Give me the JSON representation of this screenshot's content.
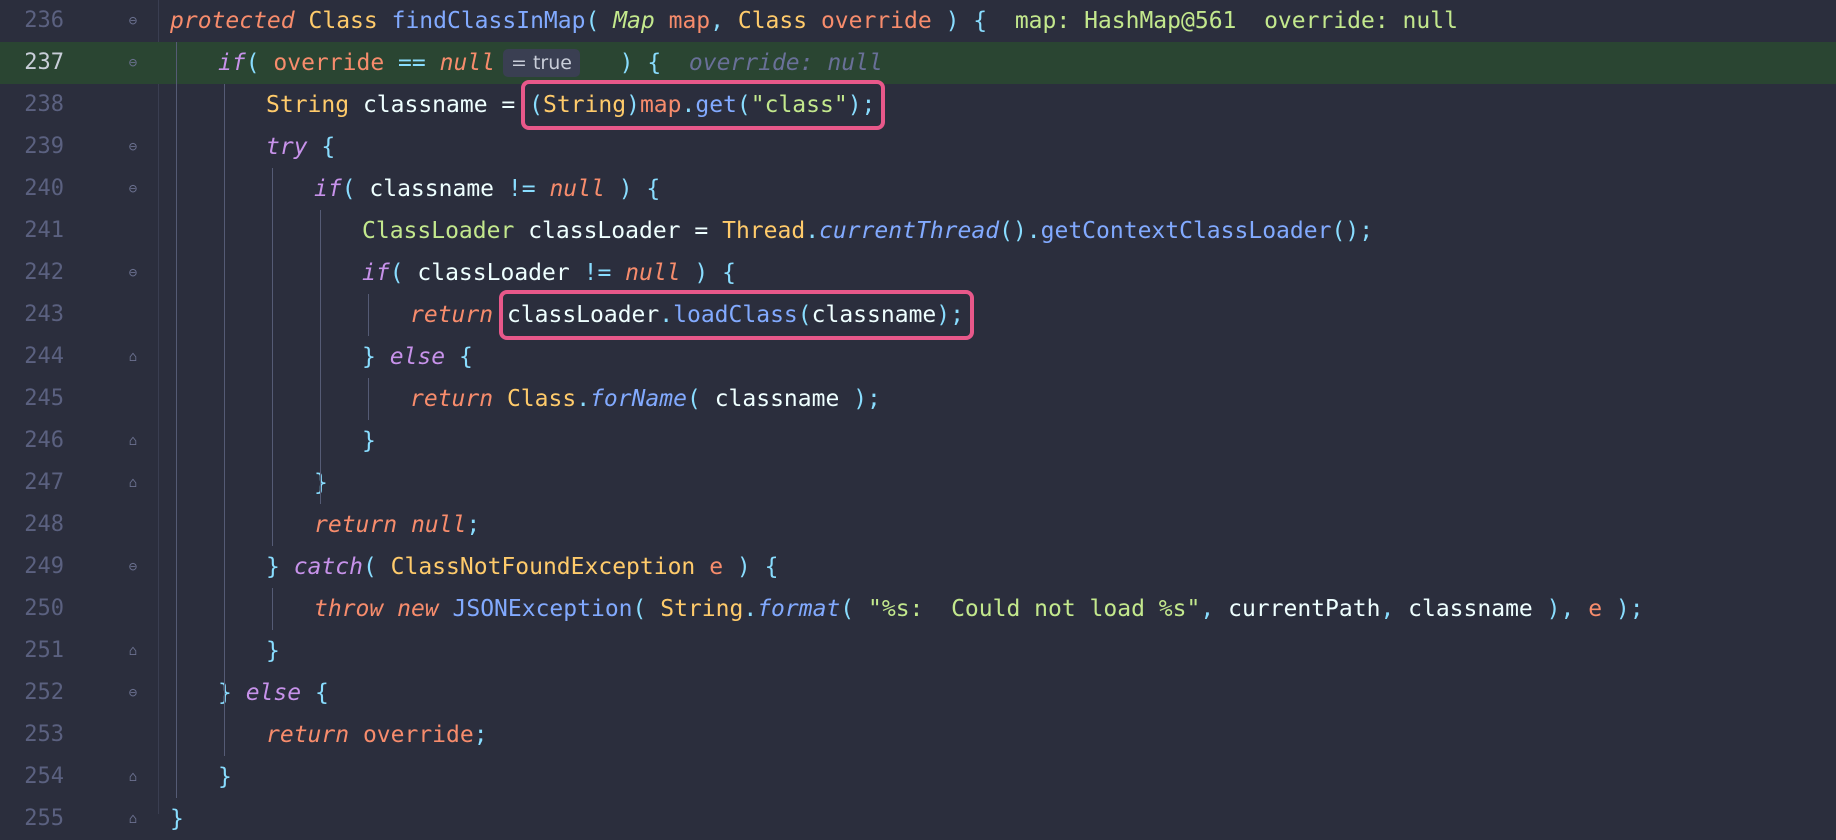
{
  "editor": {
    "current_line": 237,
    "colors": {
      "background": "#2b2e3d",
      "current_line": "#2a4532",
      "highlight_box": "#e8588a"
    },
    "lines": [
      {
        "no": "236",
        "fold": "open",
        "indent": 0,
        "tokens": [
          {
            "t": "protected",
            "c": "c-kwo"
          },
          {
            "t": " "
          },
          {
            "t": "Class",
            "c": "c-type"
          },
          {
            "t": " "
          },
          {
            "t": "findClassInMap",
            "c": "c-fn"
          },
          {
            "t": "( ",
            "c": "c-punc"
          },
          {
            "t": "Map",
            "c": "c-ital"
          },
          {
            "t": " "
          },
          {
            "t": "map",
            "c": "c-param"
          },
          {
            "t": ", ",
            "c": "c-punc"
          },
          {
            "t": "Class",
            "c": "c-type"
          },
          {
            "t": " "
          },
          {
            "t": "override",
            "c": "c-param"
          },
          {
            "t": " ) {",
            "c": "c-punc"
          },
          {
            "t": "  map: HashMap@561  override: null",
            "c": "c-dbg"
          }
        ]
      },
      {
        "no": "237",
        "fold": "open",
        "indent": 1,
        "tokens": [
          {
            "t": "if",
            "c": "c-kw"
          },
          {
            "t": "( ",
            "c": "c-punc"
          },
          {
            "t": "override",
            "c": "c-param"
          },
          {
            "t": " == ",
            "c": "c-punc"
          },
          {
            "t": "null",
            "c": "c-kwo"
          },
          {
            "t": "         ",
            "c": "c-id"
          },
          {
            "t": ") {",
            "c": "c-punc"
          },
          {
            "t": "  override: null",
            "c": "c-cmt"
          }
        ],
        "inline_value": "= true"
      },
      {
        "no": "238",
        "fold": "none",
        "indent": 2,
        "tokens": [
          {
            "t": "String",
            "c": "c-type"
          },
          {
            "t": " classname = ",
            "c": "c-id"
          },
          {
            "t": "(",
            "c": "c-punc"
          },
          {
            "t": "String",
            "c": "c-type"
          },
          {
            "t": ")",
            "c": "c-punc"
          },
          {
            "t": "map",
            "c": "c-param"
          },
          {
            "t": ".",
            "c": "c-punc"
          },
          {
            "t": "get",
            "c": "c-fn"
          },
          {
            "t": "(",
            "c": "c-punc"
          },
          {
            "t": "\"class\"",
            "c": "c-str"
          },
          {
            "t": ");",
            "c": "c-punc"
          }
        ]
      },
      {
        "no": "239",
        "fold": "open",
        "indent": 2,
        "tokens": [
          {
            "t": "try",
            "c": "c-kw"
          },
          {
            "t": " {",
            "c": "c-punc"
          }
        ]
      },
      {
        "no": "240",
        "fold": "open",
        "indent": 3,
        "tokens": [
          {
            "t": "if",
            "c": "c-kw"
          },
          {
            "t": "( ",
            "c": "c-punc"
          },
          {
            "t": "classname",
            "c": "c-id"
          },
          {
            "t": " != ",
            "c": "c-punc"
          },
          {
            "t": "null",
            "c": "c-kwo"
          },
          {
            "t": " ) {",
            "c": "c-punc"
          }
        ]
      },
      {
        "no": "241",
        "fold": "none",
        "indent": 4,
        "tokens": [
          {
            "t": "ClassLoader",
            "c": "c-typeg"
          },
          {
            "t": " classLoader = ",
            "c": "c-id"
          },
          {
            "t": "Thread",
            "c": "c-type"
          },
          {
            "t": ".",
            "c": "c-punc"
          },
          {
            "t": "currentThread",
            "c": "c-fni"
          },
          {
            "t": "().",
            "c": "c-punc"
          },
          {
            "t": "getContextClassLoader",
            "c": "c-fn"
          },
          {
            "t": "();",
            "c": "c-punc"
          }
        ]
      },
      {
        "no": "242",
        "fold": "open",
        "indent": 4,
        "tokens": [
          {
            "t": "if",
            "c": "c-kw"
          },
          {
            "t": "( ",
            "c": "c-punc"
          },
          {
            "t": "classLoader",
            "c": "c-id"
          },
          {
            "t": " != ",
            "c": "c-punc"
          },
          {
            "t": "null",
            "c": "c-kwo"
          },
          {
            "t": " ) {",
            "c": "c-punc"
          }
        ]
      },
      {
        "no": "243",
        "fold": "none",
        "indent": 5,
        "tokens": [
          {
            "t": "return",
            "c": "c-kwo"
          },
          {
            "t": " "
          },
          {
            "t": "classLoader",
            "c": "c-id"
          },
          {
            "t": ".",
            "c": "c-punc"
          },
          {
            "t": "loadClass",
            "c": "c-fn"
          },
          {
            "t": "(",
            "c": "c-punc"
          },
          {
            "t": "classname",
            "c": "c-id"
          },
          {
            "t": ");",
            "c": "c-punc"
          }
        ]
      },
      {
        "no": "244",
        "fold": "close",
        "indent": 4,
        "tokens": [
          {
            "t": "} ",
            "c": "c-punc"
          },
          {
            "t": "else",
            "c": "c-kw"
          },
          {
            "t": " {",
            "c": "c-punc"
          }
        ]
      },
      {
        "no": "245",
        "fold": "none",
        "indent": 5,
        "tokens": [
          {
            "t": "return",
            "c": "c-kwo"
          },
          {
            "t": " "
          },
          {
            "t": "Class",
            "c": "c-type"
          },
          {
            "t": ".",
            "c": "c-punc"
          },
          {
            "t": "forName",
            "c": "c-fni"
          },
          {
            "t": "( ",
            "c": "c-punc"
          },
          {
            "t": "classname",
            "c": "c-id"
          },
          {
            "t": " );",
            "c": "c-punc"
          }
        ]
      },
      {
        "no": "246",
        "fold": "close",
        "indent": 4,
        "tokens": [
          {
            "t": "}",
            "c": "c-punc"
          }
        ]
      },
      {
        "no": "247",
        "fold": "close",
        "indent": 3,
        "tokens": [
          {
            "t": "}",
            "c": "c-punc"
          }
        ]
      },
      {
        "no": "248",
        "fold": "none",
        "indent": 3,
        "tokens": [
          {
            "t": "return",
            "c": "c-kwo"
          },
          {
            "t": " "
          },
          {
            "t": "null",
            "c": "c-kwo"
          },
          {
            "t": ";",
            "c": "c-punc"
          }
        ]
      },
      {
        "no": "249",
        "fold": "open",
        "indent": 2,
        "tokens": [
          {
            "t": "} ",
            "c": "c-punc"
          },
          {
            "t": "catch",
            "c": "c-kw"
          },
          {
            "t": "( ",
            "c": "c-punc"
          },
          {
            "t": "ClassNotFoundException",
            "c": "c-type"
          },
          {
            "t": " "
          },
          {
            "t": "e",
            "c": "c-param"
          },
          {
            "t": " ) {",
            "c": "c-punc"
          }
        ]
      },
      {
        "no": "250",
        "fold": "none",
        "indent": 3,
        "tokens": [
          {
            "t": "throw",
            "c": "c-kwo"
          },
          {
            "t": " "
          },
          {
            "t": "new",
            "c": "c-kwo"
          },
          {
            "t": " "
          },
          {
            "t": "JSONException",
            "c": "c-fn"
          },
          {
            "t": "( ",
            "c": "c-punc"
          },
          {
            "t": "String",
            "c": "c-type"
          },
          {
            "t": ".",
            "c": "c-punc"
          },
          {
            "t": "format",
            "c": "c-fni"
          },
          {
            "t": "( ",
            "c": "c-punc"
          },
          {
            "t": "\"%s:  Could not load %s\"",
            "c": "c-str"
          },
          {
            "t": ", ",
            "c": "c-punc"
          },
          {
            "t": "currentPath",
            "c": "c-id"
          },
          {
            "t": ", ",
            "c": "c-punc"
          },
          {
            "t": "classname",
            "c": "c-id"
          },
          {
            "t": " ), ",
            "c": "c-punc"
          },
          {
            "t": "e",
            "c": "c-param"
          },
          {
            "t": " );",
            "c": "c-punc"
          }
        ]
      },
      {
        "no": "251",
        "fold": "close",
        "indent": 2,
        "tokens": [
          {
            "t": "}",
            "c": "c-punc"
          }
        ]
      },
      {
        "no": "252",
        "fold": "open",
        "indent": 1,
        "tokens": [
          {
            "t": "} ",
            "c": "c-punc"
          },
          {
            "t": "else",
            "c": "c-kw"
          },
          {
            "t": " {",
            "c": "c-punc"
          }
        ]
      },
      {
        "no": "253",
        "fold": "none",
        "indent": 2,
        "tokens": [
          {
            "t": "return",
            "c": "c-kwo"
          },
          {
            "t": " "
          },
          {
            "t": "override",
            "c": "c-param"
          },
          {
            "t": ";",
            "c": "c-punc"
          }
        ]
      },
      {
        "no": "254",
        "fold": "close",
        "indent": 1,
        "tokens": [
          {
            "t": "}",
            "c": "c-punc"
          }
        ]
      },
      {
        "no": "255",
        "fold": "close",
        "indent": 0,
        "tokens": [
          {
            "t": "}",
            "c": "c-punc"
          }
        ]
      }
    ],
    "annotations": [
      {
        "label": "highlight-cast-map-get",
        "line": "238"
      },
      {
        "label": "highlight-loadclass-call",
        "line": "243"
      }
    ]
  }
}
